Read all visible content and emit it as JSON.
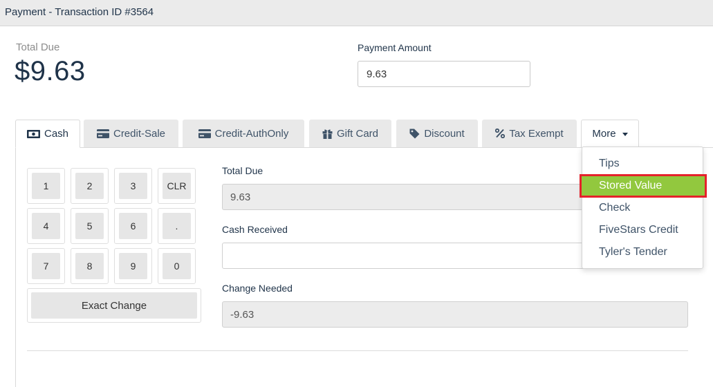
{
  "window": {
    "title": "Payment - Transaction ID #3564"
  },
  "summary": {
    "total_due_label": "Total Due",
    "total_due_value": "$9.63",
    "payment_amount_label": "Payment Amount",
    "payment_amount_value": "9.63"
  },
  "tabs": [
    {
      "label": "Cash",
      "icon": "money-bill-icon",
      "active": true
    },
    {
      "label": "Credit-Sale",
      "icon": "credit-card-icon"
    },
    {
      "label": "Credit-AuthOnly",
      "icon": "credit-card-icon"
    },
    {
      "label": "Gift Card",
      "icon": "gift-icon"
    },
    {
      "label": "Discount",
      "icon": "tag-icon"
    },
    {
      "label": "Tax Exempt",
      "icon": "percent-icon"
    }
  ],
  "more": {
    "label": "More",
    "icon": "caret-down-icon",
    "items": [
      {
        "label": "Tips"
      },
      {
        "label": "Stored Value",
        "highlighted": true
      },
      {
        "label": "Check"
      },
      {
        "label": "FiveStars Credit"
      },
      {
        "label": "Tyler's Tender"
      }
    ]
  },
  "keypad": {
    "keys": [
      "1",
      "2",
      "3",
      "CLR",
      "4",
      "5",
      "6",
      ".",
      "7",
      "8",
      "9",
      "0"
    ],
    "exact_change": "Exact Change"
  },
  "cash_form": {
    "total_due_label": "Total Due",
    "total_due_value": "9.63",
    "cash_received_label": "Cash Received",
    "cash_received_value": "",
    "change_needed_label": "Change Needed",
    "change_needed_value": "-9.63"
  },
  "colors": {
    "highlight_bg": "#92c83e",
    "highlight_border": "#e5212b",
    "text_primary": "#1f3349"
  }
}
